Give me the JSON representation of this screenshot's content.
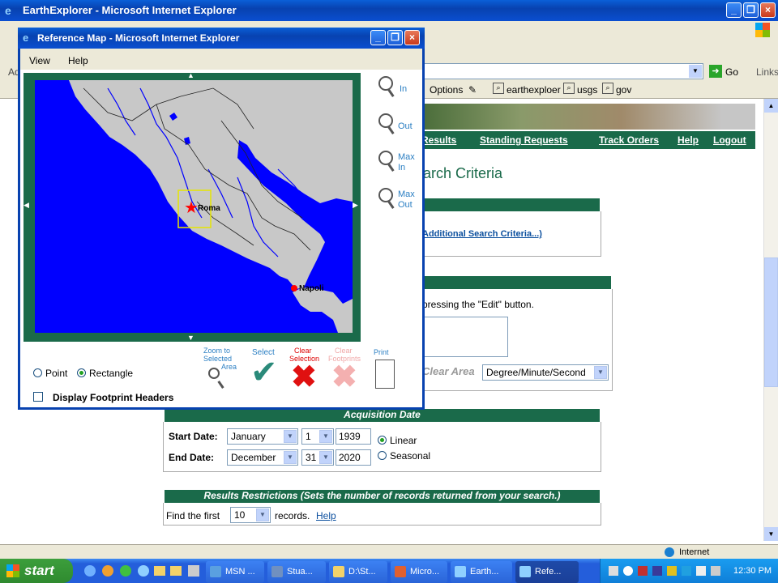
{
  "main_window": {
    "title": "EarthExplorer - Microsoft Internet Explorer",
    "address_go": "Go",
    "links_label": "Links",
    "addr_prefix": "Ad",
    "toolbar_items": [
      "Options",
      "earthexploer",
      "usgs",
      "gov"
    ]
  },
  "site": {
    "nav": [
      "Results",
      "Standing Requests",
      "Track Orders",
      "Help",
      "Logout"
    ],
    "heading": "Search Criteria",
    "additional_link": "Additional Search Criteria...)",
    "edit_hint": "pressing the \"Edit\" button.",
    "clear_area": "Clear Area",
    "coord_format": "Degree/Minute/Second",
    "acq": {
      "header": "Acquisition Date",
      "start_label": "Start Date:",
      "end_label": "End Date:",
      "start_month": "January",
      "start_day": "1",
      "start_year": "1939",
      "end_month": "December",
      "end_day": "31",
      "end_year": "2020",
      "linear": "Linear",
      "seasonal": "Seasonal"
    },
    "results": {
      "header": "Results Restrictions (Sets the number of records returned from your search.)",
      "find_first": "Find the first",
      "count": "10",
      "records": "records.",
      "help": "Help"
    }
  },
  "popup": {
    "title": "Reference Map - Microsoft Internet Explorer",
    "menu": [
      "View",
      "Help"
    ],
    "zoom": {
      "in": "In",
      "out": "Out",
      "max_in": [
        "Max",
        "In"
      ],
      "max_out": [
        "Max",
        "Out"
      ]
    },
    "cities": {
      "rome": "Roma",
      "naples": "Napoli"
    },
    "point": "Point",
    "rectangle": "Rectangle",
    "display_footprint": "Display Footprint Headers",
    "tools": {
      "zoom_sel": [
        "Zoom to",
        "Selected",
        "Area"
      ],
      "select": "Select",
      "clear_sel": [
        "Clear",
        "Selection"
      ],
      "clear_fp": [
        "Clear",
        "Footprints"
      ],
      "print": "Print"
    }
  },
  "status": {
    "zone": "Internet"
  },
  "taskbar": {
    "start": "start",
    "tasks": [
      "MSN ...",
      "Stua...",
      "D:\\St...",
      "Micro...",
      "Earth...",
      "Refe..."
    ],
    "clock": "12:30 PM"
  },
  "colors": {
    "accent": "#1a6a4a",
    "water": "#0000ff",
    "land": "#c8c8c8"
  }
}
